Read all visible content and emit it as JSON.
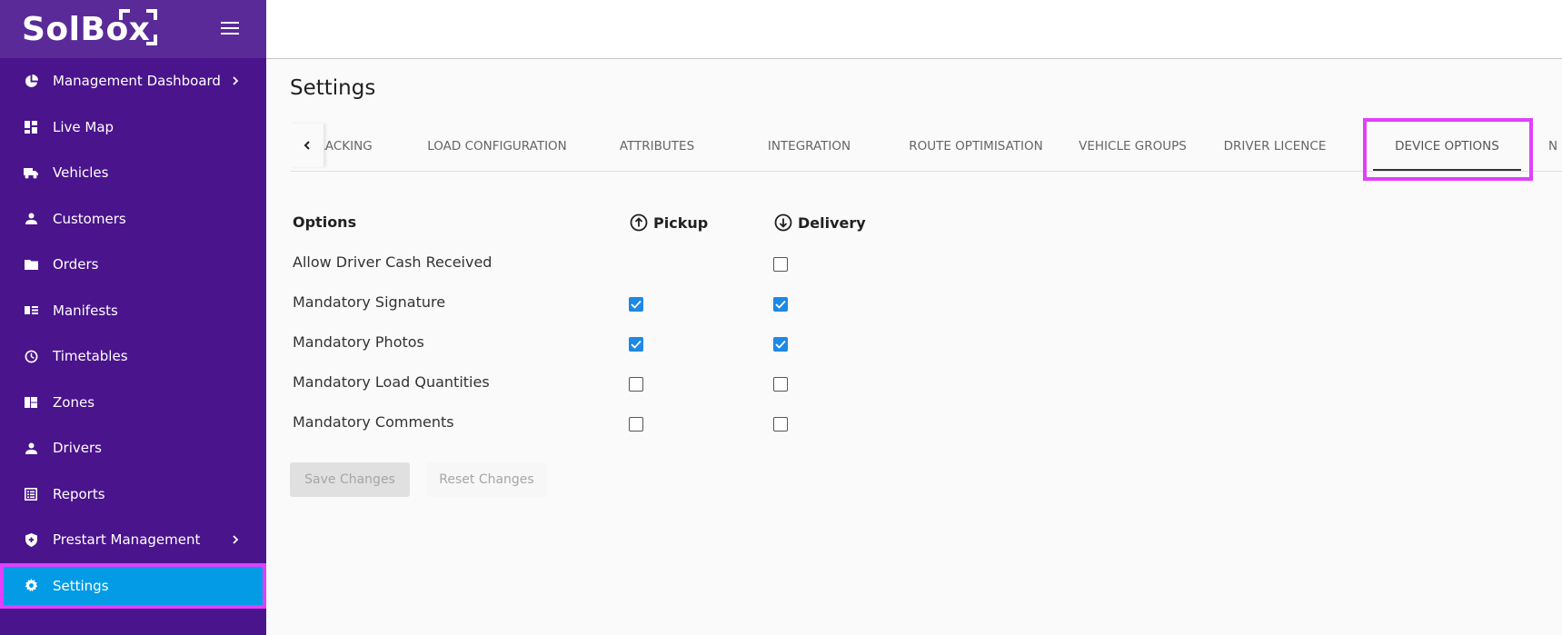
{
  "brand": {
    "name": "SolBox"
  },
  "sidebar": {
    "items": [
      {
        "label": "Management Dashboard",
        "icon": "pie-chart-icon",
        "has_chevron": true
      },
      {
        "label": "Live Map",
        "icon": "dashboard-grid-icon"
      },
      {
        "label": "Vehicles",
        "icon": "truck-icon"
      },
      {
        "label": "Customers",
        "icon": "person-icon"
      },
      {
        "label": "Orders",
        "icon": "folder-icon"
      },
      {
        "label": "Manifests",
        "icon": "list-card-icon"
      },
      {
        "label": "Timetables",
        "icon": "clock-icon"
      },
      {
        "label": "Zones",
        "icon": "zones-grid-icon"
      },
      {
        "label": "Drivers",
        "icon": "person-icon"
      },
      {
        "label": "Reports",
        "icon": "report-list-icon"
      },
      {
        "label": "Prestart Management",
        "icon": "shield-icon",
        "has_chevron": true
      },
      {
        "label": "Settings",
        "icon": "gear-icon",
        "active": true
      }
    ]
  },
  "page": {
    "title": "Settings"
  },
  "tabs": [
    {
      "label": "RACKING"
    },
    {
      "label": "LOAD CONFIGURATION"
    },
    {
      "label": "ATTRIBUTES"
    },
    {
      "label": "INTEGRATION"
    },
    {
      "label": "ROUTE OPTIMISATION"
    },
    {
      "label": "VEHICLE GROUPS"
    },
    {
      "label": "DRIVER LICENCE"
    },
    {
      "label": "DEVICE OPTIONS",
      "selected": true
    },
    {
      "label": "N"
    }
  ],
  "options": {
    "header_label": "Options",
    "pickup_label": "Pickup",
    "delivery_label": "Delivery",
    "rows": [
      {
        "label": "Allow Driver Cash Received",
        "pickup": null,
        "delivery": false
      },
      {
        "label": "Mandatory Signature",
        "pickup": true,
        "delivery": true
      },
      {
        "label": "Mandatory Photos",
        "pickup": true,
        "delivery": true
      },
      {
        "label": "Mandatory Load Quantities",
        "pickup": false,
        "delivery": false
      },
      {
        "label": "Mandatory Comments",
        "pickup": false,
        "delivery": false
      }
    ]
  },
  "actions": {
    "save_label": "Save Changes",
    "reset_label": "Reset Changes"
  },
  "colors": {
    "sidebar_bg": "#4a148c",
    "active_bg": "#039be5",
    "highlight": "#e040fb",
    "checkbox_checked": "#1e88e5"
  }
}
